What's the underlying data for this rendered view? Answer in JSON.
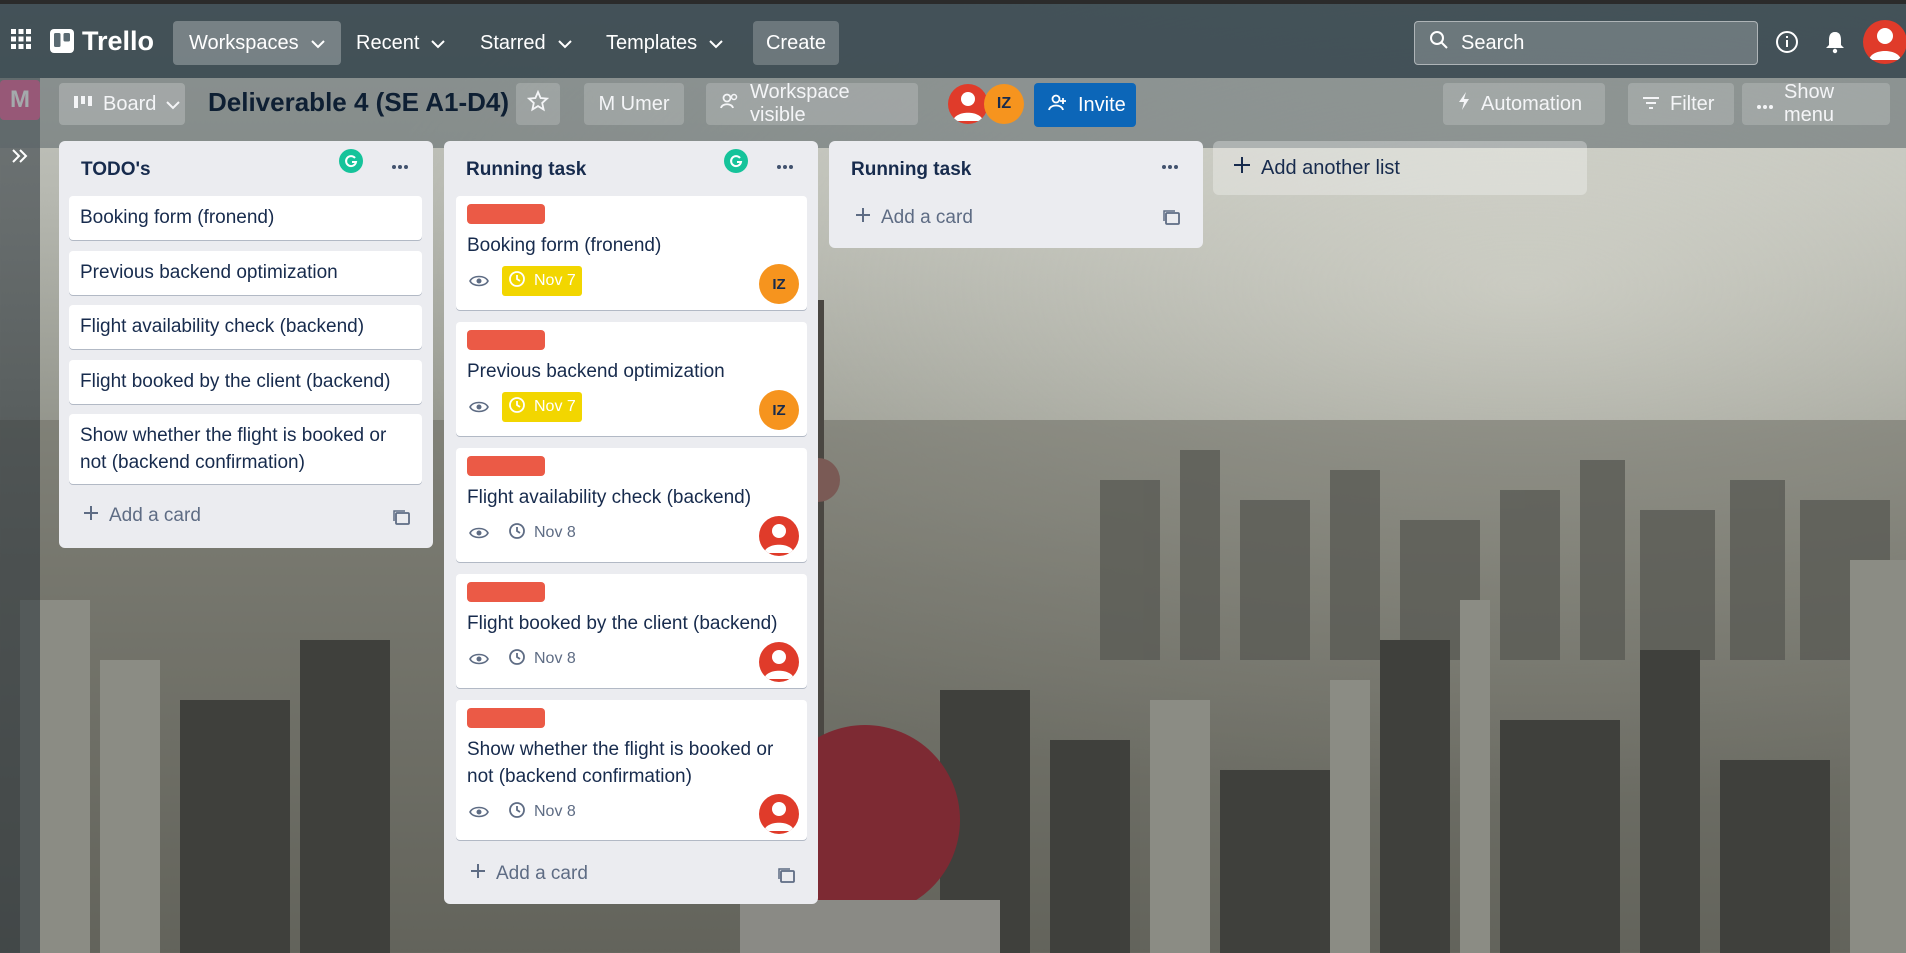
{
  "topbar": {
    "logo": "Trello",
    "nav": [
      {
        "label": "Workspaces"
      },
      {
        "label": "Recent"
      },
      {
        "label": "Starred"
      },
      {
        "label": "Templates"
      }
    ],
    "create_label": "Create",
    "search_placeholder": "Search"
  },
  "boardbar": {
    "workspace_letter": "M",
    "view_label": "Board",
    "title": "Deliverable 4 (SE A1-D4)",
    "member_name": "M Umer",
    "visibility_label": "Workspace visible",
    "member_initials": "IZ",
    "invite_label": "Invite",
    "automation_label": "Automation",
    "filter_label": "Filter",
    "show_menu_label": "Show menu"
  },
  "lists": [
    {
      "title": "TODO's",
      "cards": [
        {
          "text": "Booking form (fronend)"
        },
        {
          "text": "Previous backend optimization"
        },
        {
          "text": "Flight availability check (backend)"
        },
        {
          "text": "Flight booked by the client (backend)"
        },
        {
          "text": "Show whether the flight is booked or not (backend confirmation)"
        }
      ],
      "add_card_label": "Add a card"
    },
    {
      "title": "Running task",
      "cards": [
        {
          "text": "Booking form (fronend)",
          "due": "Nov 7",
          "member": "IZ"
        },
        {
          "text": "Previous backend optimization",
          "due": "Nov 7",
          "member": "IZ"
        },
        {
          "text": "Flight availability check (backend)",
          "due": "Nov 8"
        },
        {
          "text": "Flight booked by the client (backend)",
          "due": "Nov 8"
        },
        {
          "text": "Show whether the flight is booked or not (backend confirmation)",
          "due": "Nov 8"
        }
      ],
      "add_card_label": "Add a card"
    },
    {
      "title": "Running task",
      "add_card_label": "Add a card"
    }
  ],
  "add_list_label": "Add another list",
  "colors": {
    "label_red": "#eb5a46",
    "due_warning": "#f2d600",
    "invite_blue": "#0c66b8",
    "member_orange": "#f6941e",
    "avatar_red": "#e03b2a",
    "workspace_pink": "#e2498a"
  }
}
